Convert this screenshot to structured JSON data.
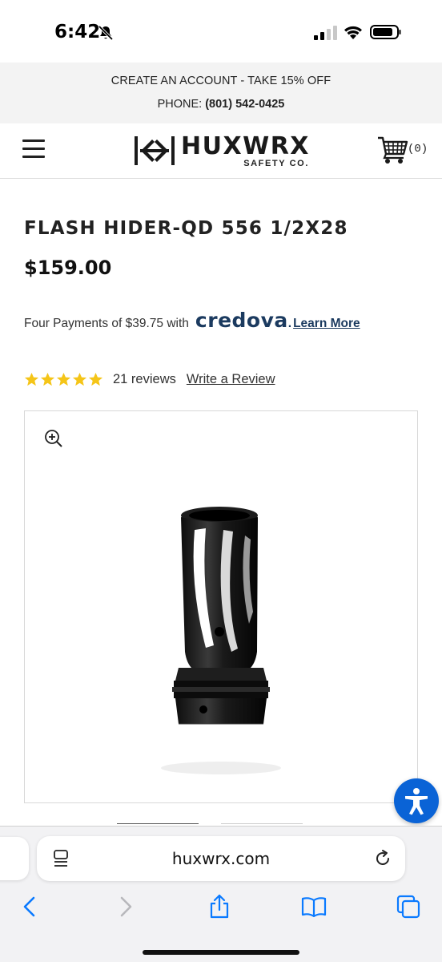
{
  "status_bar": {
    "time": "6:42"
  },
  "promo": {
    "line1": "CREATE AN ACCOUNT - TAKE 15% OFF",
    "phone_label": "PHONE: ",
    "phone_number": "(801) 542-0425"
  },
  "header": {
    "brand": "HUXWRX",
    "brand_sub": "SAFETY CO.",
    "cart_count": "(0)"
  },
  "product": {
    "title": "FLASH HIDER-QD 556 1/2X28",
    "price": "$159.00",
    "financing_text": "Four Payments of $39.75 with",
    "financing_brand": "credova",
    "financing_link": "Learn More",
    "rating_stars": 5,
    "review_count": "21 reviews",
    "write_review": "Write a Review"
  },
  "browser": {
    "url": "huxwrx.com"
  },
  "colors": {
    "accent": "#1b3a5f",
    "star": "#f5c518",
    "accessibility": "#0a63d6",
    "safari_blue": "#0a7aff"
  }
}
